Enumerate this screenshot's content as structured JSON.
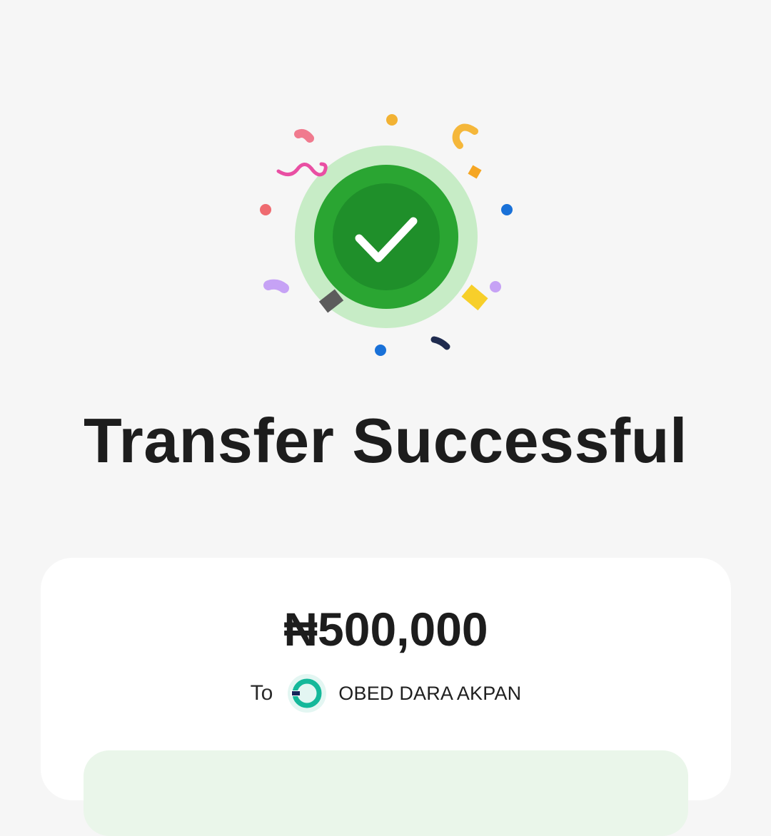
{
  "status": {
    "icon": "check-icon",
    "title": "Transfer Successful"
  },
  "transfer": {
    "amount": "₦500,000",
    "to_label": "To",
    "recipient_name": "OBED DARA AKPAN",
    "recipient_bank_icon": "bank-logo-icon"
  },
  "colors": {
    "background": "#f6f6f6",
    "success_green": "#1f9a2c",
    "success_ring": "#c7ecc6",
    "card": "#ffffff",
    "details_panel": "#eaf6ea",
    "text": "#1d1d1d"
  }
}
